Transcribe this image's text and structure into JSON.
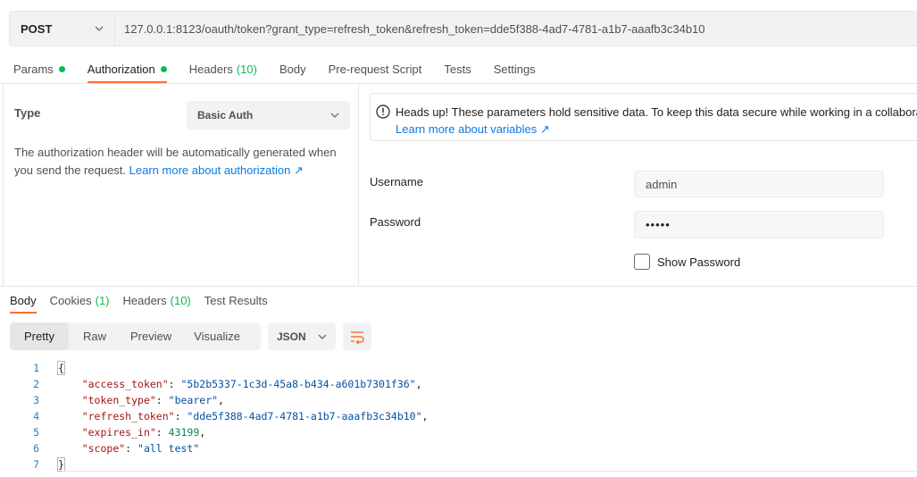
{
  "request": {
    "method": "POST",
    "url": "127.0.0.1:8123/oauth/token?grant_type=refresh_token&refresh_token=dde5f388-4ad7-4781-a1b7-aaafb3c34b10"
  },
  "request_tabs": [
    {
      "label": "Params",
      "dot": true
    },
    {
      "label": "Authorization",
      "dot": true,
      "active": true
    },
    {
      "label": "Headers",
      "count": "(10)"
    },
    {
      "label": "Body"
    },
    {
      "label": "Pre-request Script"
    },
    {
      "label": "Tests"
    },
    {
      "label": "Settings"
    }
  ],
  "auth": {
    "type_label": "Type",
    "type_value": "Basic Auth",
    "description": "The authorization header will be automatically generated when you send the request.",
    "description_link": "Learn more about authorization ↗",
    "notice_text": "Heads up! These parameters hold sensitive data. To keep this data secure while working in a collaborat",
    "notice_link": "Learn more about variables ↗",
    "username_label": "Username",
    "username_value": "admin",
    "password_label": "Password",
    "password_value": "•••••",
    "show_password_label": "Show Password"
  },
  "response_tabs": [
    {
      "label": "Body",
      "active": true
    },
    {
      "label": "Cookies",
      "count": "(1)"
    },
    {
      "label": "Headers",
      "count": "(10)"
    },
    {
      "label": "Test Results"
    }
  ],
  "view_modes": [
    "Pretty",
    "Raw",
    "Preview",
    "Visualize"
  ],
  "format": "JSON",
  "response_body": [
    {
      "n": "1",
      "parts": [
        [
          "pun",
          "{"
        ]
      ]
    },
    {
      "n": "2",
      "parts": [
        [
          "pun",
          "    "
        ],
        [
          "key",
          "\"access_token\""
        ],
        [
          "pun",
          ": "
        ],
        [
          "str",
          "\"5b2b5337-1c3d-45a8-b434-a601b7301f36\""
        ],
        [
          "pun",
          ","
        ]
      ]
    },
    {
      "n": "3",
      "parts": [
        [
          "pun",
          "    "
        ],
        [
          "key",
          "\"token_type\""
        ],
        [
          "pun",
          ": "
        ],
        [
          "str",
          "\"bearer\""
        ],
        [
          "pun",
          ","
        ]
      ]
    },
    {
      "n": "4",
      "parts": [
        [
          "pun",
          "    "
        ],
        [
          "key",
          "\"refresh_token\""
        ],
        [
          "pun",
          ": "
        ],
        [
          "str",
          "\"dde5f388-4ad7-4781-a1b7-aaafb3c34b10\""
        ],
        [
          "pun",
          ","
        ]
      ]
    },
    {
      "n": "5",
      "parts": [
        [
          "pun",
          "    "
        ],
        [
          "key",
          "\"expires_in\""
        ],
        [
          "pun",
          ": "
        ],
        [
          "num",
          "43199"
        ],
        [
          "pun",
          ","
        ]
      ]
    },
    {
      "n": "6",
      "parts": [
        [
          "pun",
          "    "
        ],
        [
          "key",
          "\"scope\""
        ],
        [
          "pun",
          ": "
        ],
        [
          "str",
          "\"all test\""
        ]
      ]
    },
    {
      "n": "7",
      "parts": [
        [
          "pun",
          "}"
        ]
      ]
    }
  ],
  "colors": {
    "accent": "#ff6c37",
    "link": "#097bed",
    "success": "#0cbb52"
  }
}
